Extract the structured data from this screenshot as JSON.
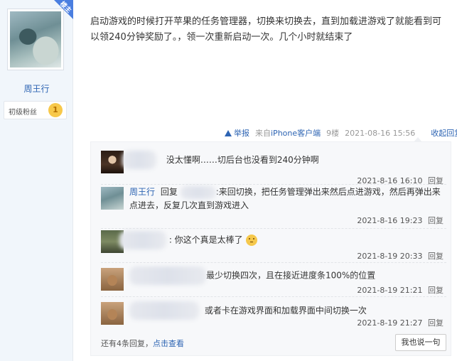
{
  "author": {
    "badge": "楼主",
    "name": "周王行",
    "level_title": "初级粉丝",
    "level_num": "1"
  },
  "post": {
    "text": "启动游戏的时候打开苹果的任务管理器，切换来切换去，直到加载进游戏了就能看到可以领240分钟奖励了。，领一次重新启动一次。几个小时就结束了",
    "report": "举报",
    "source_prefix": "来自",
    "source_client": "iPhone客户端",
    "floor": "9楼",
    "time": "2021-08-16 15:56",
    "collapse_reply": "收起回复"
  },
  "replies": [
    {
      "text": "没太懂啊……切后台也没看到240分钟啊",
      "time": "2021-8-16 16:10",
      "reply_label": "回复"
    },
    {
      "name": "周王行",
      "reply_prefix": ":",
      "reply_word": "回复",
      "text": ":来回切换，把任务管理弹出来然后点进游戏，然后再弹出来点进去，反复几次直到游戏进入",
      "time": "2021-8-16 19:23",
      "reply_label": "回复"
    },
    {
      "text": ": 你这个真是太棒了",
      "time": "2021-8-19 20:33",
      "reply_label": "回复"
    },
    {
      "text": "最少切换四次，且在接近进度条100%的位置",
      "time": "2021-8-19 21:21",
      "reply_label": "回复"
    },
    {
      "text": "或者卡在游戏界面和加载界面中间切换一次",
      "time": "2021-8-19 21:27",
      "reply_label": "回复"
    }
  ],
  "footer": {
    "more_prefix": "还有4条回复，",
    "more_link": "点击查看",
    "say_button": "我也说一句"
  },
  "colors": {
    "link": "#2d64b3",
    "sidebar_bg": "#f1f6fb",
    "badge": "#4a7ee0"
  }
}
